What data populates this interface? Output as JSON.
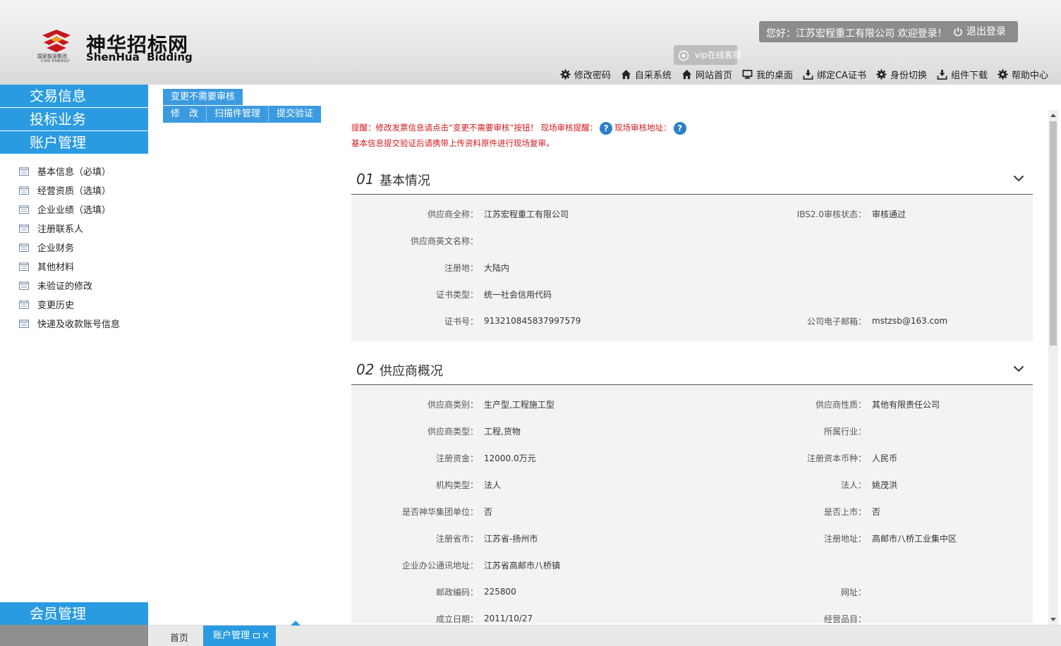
{
  "brand": {
    "name_cn": "神华招标网",
    "name_en": "ShenHua  Bidding",
    "group_cn": "国家能源集团",
    "group_en": "CHN ENERGY"
  },
  "user": {
    "greeting": "您好：江苏宏程重工有限公司  欢迎登录！",
    "logout": "退出登录"
  },
  "vip": "vip在线客服",
  "topnav": [
    {
      "label": "修改密码",
      "icon": "gear-icon"
    },
    {
      "label": "自采系统",
      "icon": "home-icon"
    },
    {
      "label": "网站首页",
      "icon": "home-icon"
    },
    {
      "label": "我的桌面",
      "icon": "monitor-icon"
    },
    {
      "label": "绑定CA证书",
      "icon": "download-icon"
    },
    {
      "label": "身份切换",
      "icon": "gear-icon"
    },
    {
      "label": "组件下载",
      "icon": "download-icon"
    },
    {
      "label": "帮助中心",
      "icon": "gear-icon"
    }
  ],
  "sidebar": {
    "menus": [
      "交易信息",
      "投标业务",
      "账户管理"
    ],
    "items": [
      "基本信息（必填）",
      "经营资质（选填）",
      "企业业绩（选填）",
      "注册联系人",
      "企业财务",
      "其他材料",
      "未验证的修改",
      "变更历史",
      "快递及收款账号信息"
    ],
    "member": "会员管理"
  },
  "toolbar": {
    "top": "变更不需要审核",
    "buttons": [
      "修　改",
      "扫描件管理",
      "提交验证"
    ]
  },
  "notice": {
    "line1a": "提醒：修改发票信息请点击“变更不需要审核”按钮！ 现场审核提醒：",
    "line1b": "现场审核地址：",
    "line2": "基本信息提交验证后请携带上传资料原件进行现场复审。",
    "help": "?"
  },
  "sections": [
    {
      "num": "01",
      "title": "基本情况",
      "rows": [
        {
          "l": "供应商全称：",
          "v": "江苏宏程重工有限公司",
          "l2": "IBS2.0审核状态：",
          "v2": "审核通过"
        },
        {
          "l": "供应商英文名称：",
          "v": "",
          "l2": "",
          "v2": ""
        },
        {
          "l": "注册地：",
          "v": "大陆内",
          "l2": "",
          "v2": ""
        },
        {
          "l": "证书类型：",
          "v": "统一社会信用代码",
          "l2": "",
          "v2": ""
        },
        {
          "l": "证书号：",
          "v": "913210845837997579",
          "l2": "公司电子邮箱：",
          "v2": "mstzsb@163.com"
        }
      ]
    },
    {
      "num": "02",
      "title": "供应商概况",
      "rows": [
        {
          "l": "供应商类别：",
          "v": "生产型,工程施工型",
          "l2": "供应商性质：",
          "v2": "其他有限责任公司"
        },
        {
          "l": "供应商类型：",
          "v": "工程,货物",
          "l2": "所属行业：",
          "v2": ""
        },
        {
          "l": "注册资金：",
          "v": "12000.0万元",
          "l2": "注册资本币种：",
          "v2": "人民币"
        },
        {
          "l": "机构类型：",
          "v": "法人",
          "l2": "法人：",
          "v2": "姚茂洪"
        },
        {
          "l": "是否神华集团单位：",
          "v": "否",
          "l2": "是否上市：",
          "v2": "否"
        },
        {
          "l": "注册省市：",
          "v": "江苏省-扬州市",
          "l2": "注册地址：",
          "v2": "高邮市八桥工业集中区"
        },
        {
          "l": "企业办公通讯地址：",
          "v": "江苏省高邮市八桥镇",
          "l2": "",
          "v2": ""
        },
        {
          "l": "邮政编码：",
          "v": "225800",
          "l2": "网址：",
          "v2": ""
        },
        {
          "l": "成立日期：",
          "v": "2011/10/27",
          "l2": "经营品目：",
          "v2": ""
        }
      ]
    }
  ],
  "tabs": {
    "home": "首页",
    "active": "账户管理",
    "close": "×"
  }
}
